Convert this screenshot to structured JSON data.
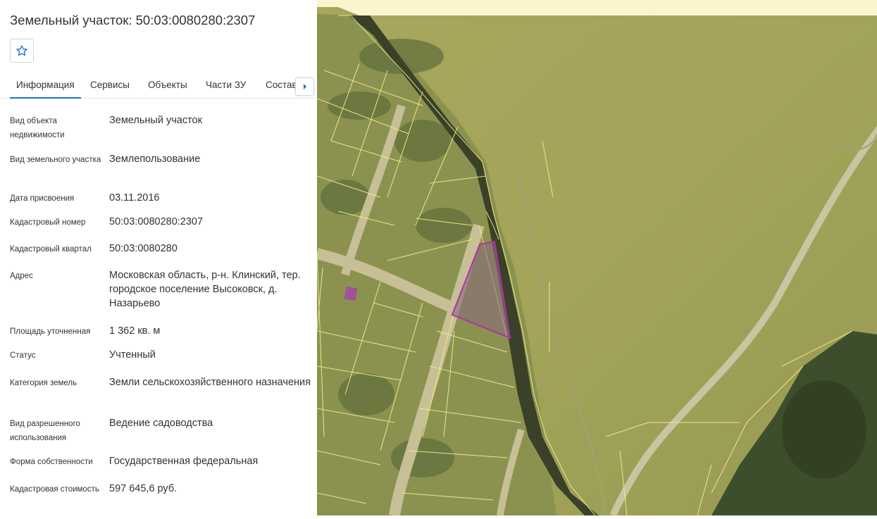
{
  "title": "Земельный участок: 50:03:0080280:2307",
  "favorite_icon": "star-outline-icon",
  "tabs": [
    {
      "label": "Информация",
      "active": true
    },
    {
      "label": "Сервисы",
      "active": false
    },
    {
      "label": "Объекты",
      "active": false
    },
    {
      "label": "Части ЗУ",
      "active": false
    },
    {
      "label": "Состав",
      "active": false
    }
  ],
  "tabs_more_icon": "caret-right-icon",
  "colors": {
    "accent": "#1a73c9",
    "parcel_outline": "#b030b0",
    "cadastral_lines": "#f5f08a"
  },
  "properties": [
    {
      "label": "Вид объекта недвижимости",
      "value": "Земельный участок"
    },
    {
      "label": "Вид земельного участка",
      "value": "Землепользование"
    },
    {
      "label": "Дата присвоения",
      "value": "03.11.2016"
    },
    {
      "label": "Кадастровый номер",
      "value": "50:03:0080280:2307"
    },
    {
      "label": "Кадастровый квартал",
      "value": "50:03:0080280"
    },
    {
      "label": "Адрес",
      "value": "Московская область, р-н. Клинский, тер. городское поселение Высоковск, д. Назарьево"
    },
    {
      "label": "Площадь уточненная",
      "value": "1 362 кв. м"
    },
    {
      "label": "Статус",
      "value": "Учтенный"
    },
    {
      "label": "Категория земель",
      "value": "Земли сельскохозяйственного назначения"
    },
    {
      "label": "Вид разрешенного использования",
      "value": "Ведение садоводства"
    },
    {
      "label": "Форма собственности",
      "value": "Государственная федеральная"
    },
    {
      "label": "Кадастровая стоимость",
      "value": "597 645,6 руб."
    }
  ]
}
